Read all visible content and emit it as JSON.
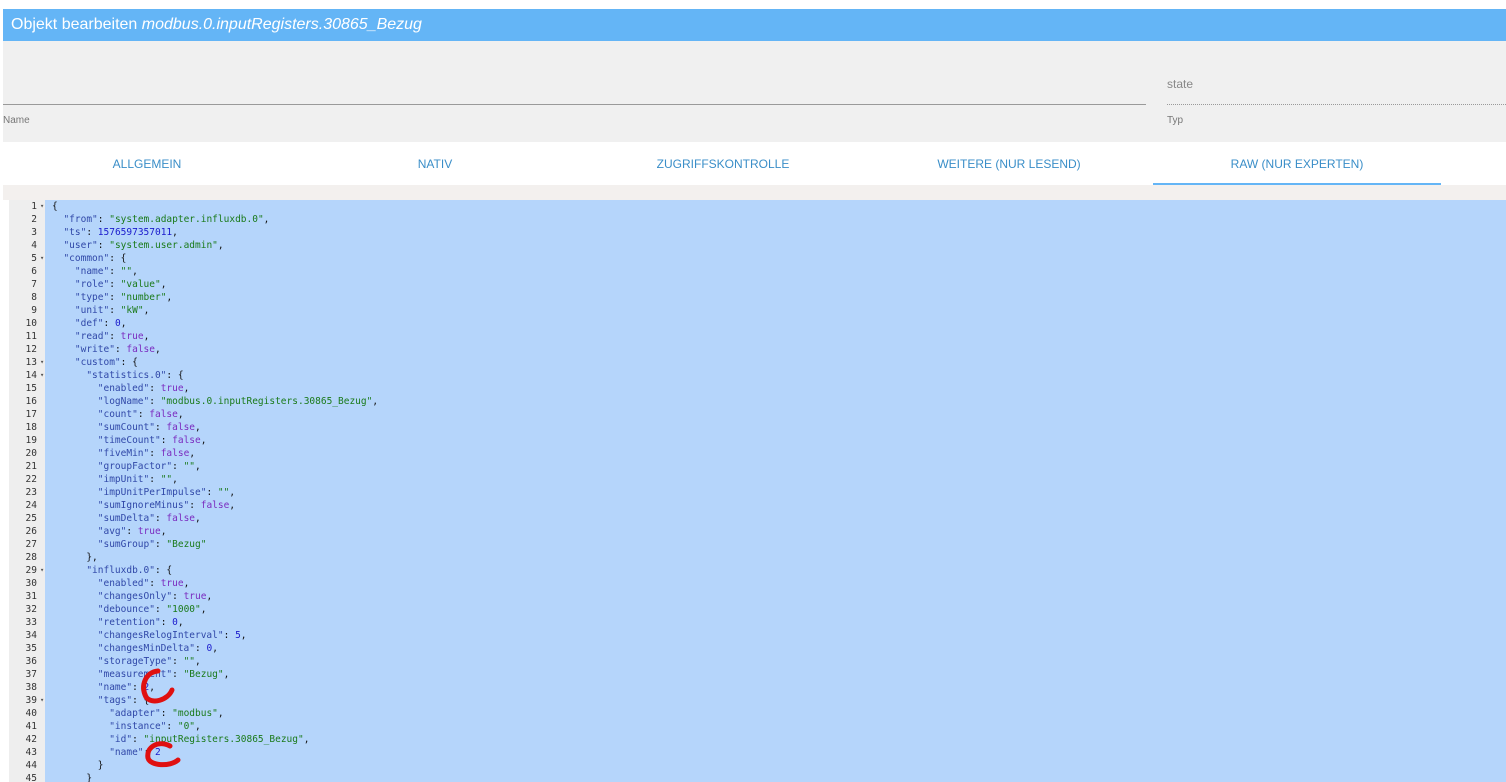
{
  "dialog": {
    "title_prefix": "Objekt bearbeiten",
    "title_object": "modbus.0.inputRegisters.30865_Bezug"
  },
  "form": {
    "name_label": "Name",
    "name_value": "",
    "type_label": "Typ",
    "type_value": "state"
  },
  "tabs": [
    {
      "label": "ALLGEMEIN",
      "active": false
    },
    {
      "label": "NATIV",
      "active": false
    },
    {
      "label": "ZUGRIFFSKONTROLLE",
      "active": false
    },
    {
      "label": "WEITERE (NUR LESEND)",
      "active": false
    },
    {
      "label": "RAW (NUR EXPERTEN)",
      "active": true
    }
  ],
  "editor": {
    "lines": [
      "{",
      "  \"from\": \"system.adapter.influxdb.0\",",
      "  \"ts\": 1576597357011,",
      "  \"user\": \"system.user.admin\",",
      "  \"common\": {",
      "    \"name\": \"\",",
      "    \"role\": \"value\",",
      "    \"type\": \"number\",",
      "    \"unit\": \"kW\",",
      "    \"def\": 0,",
      "    \"read\": true,",
      "    \"write\": false,",
      "    \"custom\": {",
      "      \"statistics.0\": {",
      "        \"enabled\": true,",
      "        \"logName\": \"modbus.0.inputRegisters.30865_Bezug\",",
      "        \"count\": false,",
      "        \"sumCount\": false,",
      "        \"timeCount\": false,",
      "        \"fiveMin\": false,",
      "        \"groupFactor\": \"\",",
      "        \"impUnit\": \"\",",
      "        \"impUnitPerImpulse\": \"\",",
      "        \"sumIgnoreMinus\": false,",
      "        \"sumDelta\": false,",
      "        \"avg\": true,",
      "        \"sumGroup\": \"Bezug\"",
      "      },",
      "      \"influxdb.0\": {",
      "        \"enabled\": true,",
      "        \"changesOnly\": true,",
      "        \"debounce\": \"1000\",",
      "        \"retention\": 0,",
      "        \"changesRelogInterval\": 5,",
      "        \"changesMinDelta\": 0,",
      "        \"storageType\": \"\",",
      "        \"measurement\": \"Bezug\",",
      "        \"name\": 2,",
      "        \"tags\": {",
      "          \"adapter\": \"modbus\",",
      "          \"instance\": \"0\",",
      "          \"id\": \"inputRegisters.30865_Bezug\",",
      "          \"name\": 2",
      "        }",
      "      }"
    ],
    "foldable_lines": [
      1,
      5,
      13,
      14,
      29,
      39
    ]
  }
}
